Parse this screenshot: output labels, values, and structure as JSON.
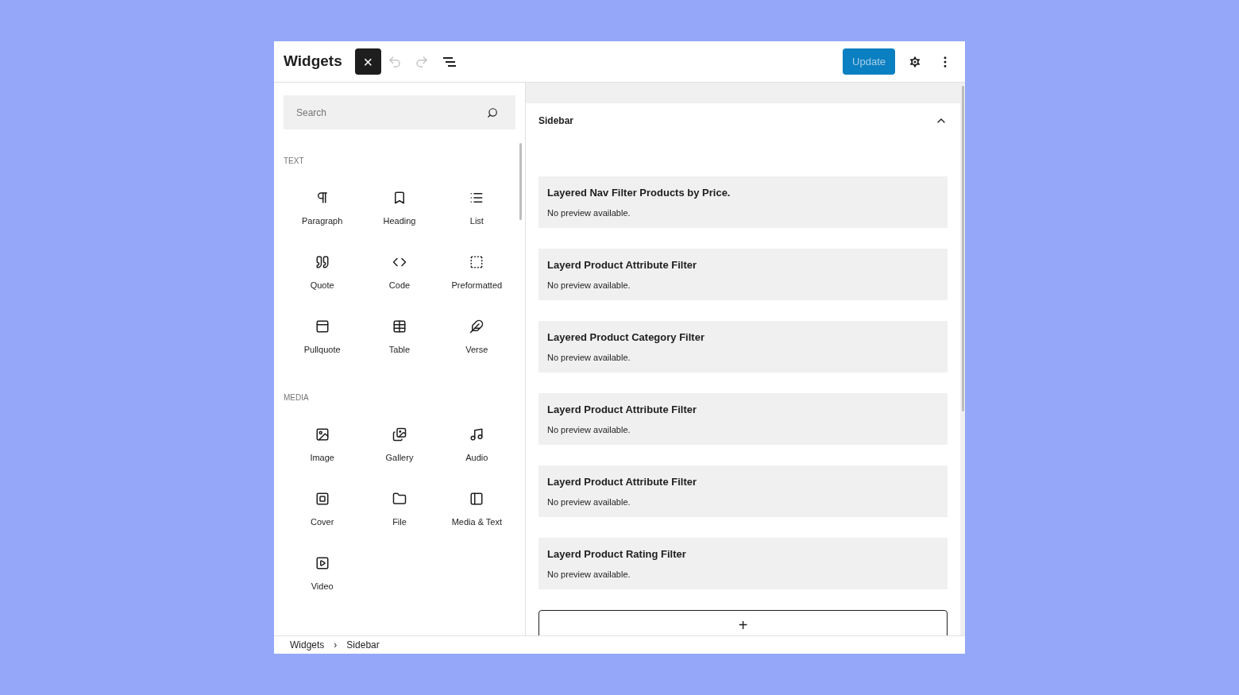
{
  "header": {
    "title": "Widgets",
    "close_button": {
      "label": "×"
    },
    "undo": {
      "disabled": true
    },
    "redo": {
      "disabled": true
    },
    "update_button": {
      "label": "Update",
      "disabled": true
    }
  },
  "inserter": {
    "search": {
      "placeholder": "Search"
    },
    "categories": [
      {
        "title": "TEXT",
        "blocks": [
          {
            "label": "Paragraph",
            "kind": "paragraph"
          },
          {
            "label": "Heading",
            "kind": "heading"
          },
          {
            "label": "List",
            "kind": "list"
          },
          {
            "label": "Quote",
            "kind": "quote"
          },
          {
            "label": "Code",
            "kind": "code"
          },
          {
            "label": "Preformatted",
            "kind": "preformatted"
          },
          {
            "label": "Pullquote",
            "kind": "pullquote"
          },
          {
            "label": "Table",
            "kind": "table"
          },
          {
            "label": "Verse",
            "kind": "verse"
          }
        ]
      },
      {
        "title": "MEDIA",
        "blocks": [
          {
            "label": "Image",
            "kind": "image"
          },
          {
            "label": "Gallery",
            "kind": "gallery"
          },
          {
            "label": "Audio",
            "kind": "audio"
          },
          {
            "label": "Cover",
            "kind": "cover"
          },
          {
            "label": "File",
            "kind": "file"
          },
          {
            "label": "Media & Text",
            "kind": "media-text"
          },
          {
            "label": "Video",
            "kind": "video"
          }
        ]
      }
    ]
  },
  "widget_area": {
    "title": "Sidebar",
    "expanded": true,
    "widgets": [
      {
        "title": "Layered Nav Filter Products by Price.",
        "note": "No preview available."
      },
      {
        "title": "Layerd Product Attribute Filter",
        "note": "No preview available."
      },
      {
        "title": "Layered Product Category Filter",
        "note": "No preview available."
      },
      {
        "title": "Layerd Product Attribute Filter",
        "note": "No preview available."
      },
      {
        "title": "Layerd Product Attribute Filter",
        "note": "No preview available."
      },
      {
        "title": "Layerd Product Rating Filter",
        "note": "No preview available."
      }
    ],
    "add_button": {
      "label": "+"
    }
  },
  "breadcrumb": [
    {
      "label": "Widgets"
    },
    {
      "label": "Sidebar"
    }
  ],
  "breadcrumb_separator": "›"
}
